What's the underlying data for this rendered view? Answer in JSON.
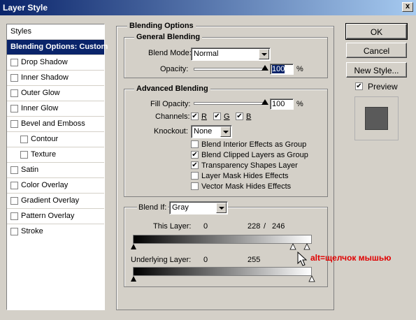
{
  "window": {
    "title": "Layer Style",
    "close_glyph": "x"
  },
  "left_panel": {
    "items": [
      {
        "label": "Styles",
        "checkbox": false,
        "checked": false,
        "selected": false,
        "sub": false
      },
      {
        "label": "Blending Options: Custom",
        "checkbox": false,
        "checked": false,
        "selected": true,
        "sub": false
      },
      {
        "label": "Drop Shadow",
        "checkbox": true,
        "checked": false,
        "selected": false,
        "sub": false
      },
      {
        "label": "Inner Shadow",
        "checkbox": true,
        "checked": false,
        "selected": false,
        "sub": false
      },
      {
        "label": "Outer Glow",
        "checkbox": true,
        "checked": false,
        "selected": false,
        "sub": false
      },
      {
        "label": "Inner Glow",
        "checkbox": true,
        "checked": false,
        "selected": false,
        "sub": false
      },
      {
        "label": "Bevel and Emboss",
        "checkbox": true,
        "checked": false,
        "selected": false,
        "sub": false
      },
      {
        "label": "Contour",
        "checkbox": true,
        "checked": false,
        "selected": false,
        "sub": true
      },
      {
        "label": "Texture",
        "checkbox": true,
        "checked": false,
        "selected": false,
        "sub": true
      },
      {
        "label": "Satin",
        "checkbox": true,
        "checked": false,
        "selected": false,
        "sub": false
      },
      {
        "label": "Color Overlay",
        "checkbox": true,
        "checked": false,
        "selected": false,
        "sub": false
      },
      {
        "label": "Gradient Overlay",
        "checkbox": true,
        "checked": false,
        "selected": false,
        "sub": false
      },
      {
        "label": "Pattern Overlay",
        "checkbox": true,
        "checked": false,
        "selected": false,
        "sub": false
      },
      {
        "label": "Stroke",
        "checkbox": true,
        "checked": false,
        "selected": false,
        "sub": false
      }
    ]
  },
  "blending_options": {
    "title": "Blending Options",
    "general": {
      "title": "General Blending",
      "blend_mode_label": "Blend Mode:",
      "blend_mode_value": "Normal",
      "opacity_label": "Opacity:",
      "opacity_value": "100",
      "opacity_unit": "%",
      "opacity_level": 1.0
    },
    "advanced": {
      "title": "Advanced Blending",
      "fill_opacity_label": "Fill Opacity:",
      "fill_opacity_value": "100",
      "fill_opacity_unit": "%",
      "fill_opacity_level": 1.0,
      "channels_label": "Channels:",
      "channels": [
        {
          "label": "R",
          "checked": true
        },
        {
          "label": "G",
          "checked": true
        },
        {
          "label": "B",
          "checked": true
        }
      ],
      "knockout_label": "Knockout:",
      "knockout_value": "None",
      "options": [
        {
          "label": "Blend Interior Effects as Group",
          "checked": false
        },
        {
          "label": "Blend Clipped Layers as Group",
          "checked": true
        },
        {
          "label": "Transparency Shapes Layer",
          "checked": true
        },
        {
          "label": "Layer Mask Hides Effects",
          "checked": false
        },
        {
          "label": "Vector Mask Hides Effects",
          "checked": false
        }
      ]
    },
    "blend_if": {
      "label": "Blend If:",
      "value": "Gray",
      "this_layer_label": "This Layer:",
      "this_layer_low": "0",
      "this_layer_high": "228",
      "this_layer_sep": "/",
      "this_layer_high2": "246",
      "underlying_label": "Underlying Layer:",
      "underlying_low": "0",
      "underlying_high": "255"
    }
  },
  "buttons": {
    "ok": "OK",
    "cancel": "Cancel",
    "new_style": "New Style..."
  },
  "preview": {
    "label": "Preview",
    "checked": true
  },
  "annotation": {
    "text": "alt=щелчок мышью",
    "color": "#e00000"
  }
}
